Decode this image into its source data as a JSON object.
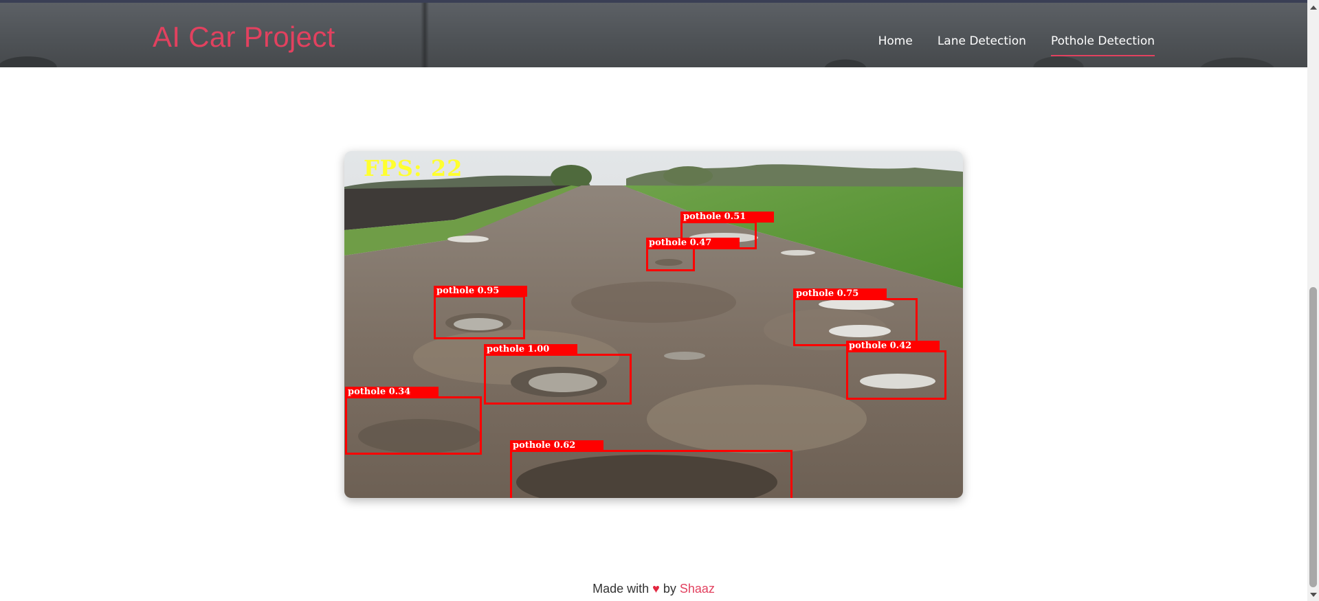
{
  "header": {
    "brand": "AI Car Project",
    "nav": [
      {
        "label": "Home",
        "active": false
      },
      {
        "label": "Lane Detection",
        "active": false
      },
      {
        "label": "Pothole Detection",
        "active": true
      }
    ]
  },
  "stream": {
    "fps_text": "FPS: 22",
    "detections": [
      {
        "label": "pothole 0.51"
      },
      {
        "label": "pothole 0.47"
      },
      {
        "label": "pothole 0.95"
      },
      {
        "label": "pothole 0.75"
      },
      {
        "label": "pothole 1.00"
      },
      {
        "label": "pothole 0.42"
      },
      {
        "label": "pothole 0.34"
      },
      {
        "label": "pothole 0.62"
      }
    ]
  },
  "footer": {
    "prefix": "Made with",
    "heart": "♥",
    "by": "by",
    "author": "Shaaz"
  },
  "colors": {
    "accent": "#e2415f",
    "box": "#ff0000",
    "fps": "#ffff2e"
  }
}
